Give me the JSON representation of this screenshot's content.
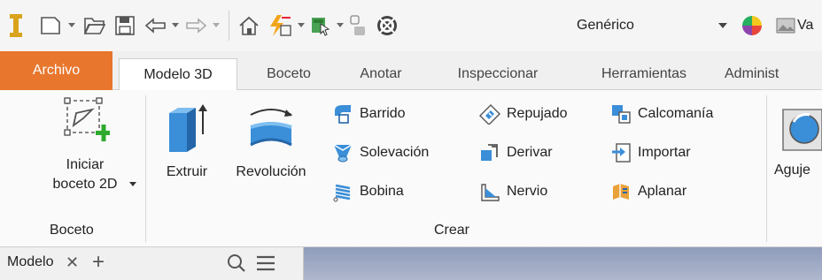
{
  "quick_access": {
    "material_value": "Genérico",
    "appearance_value": "Va"
  },
  "tabs": [
    {
      "label": "Archivo"
    },
    {
      "label": "Modelo 3D"
    },
    {
      "label": "Boceto"
    },
    {
      "label": "Anotar"
    },
    {
      "label": "Inspeccionar"
    },
    {
      "label": "Herramientas"
    },
    {
      "label": "Administ"
    }
  ],
  "ribbon": {
    "boceto_panel": {
      "title": "Boceto",
      "start_sketch_line1": "Iniciar",
      "start_sketch_line2": "boceto 2D"
    },
    "crear_panel": {
      "title": "Crear",
      "extrude": "Extruir",
      "revolve": "Revolución",
      "sweep": "Barrido",
      "loft": "Solevación",
      "coil": "Bobina",
      "emboss": "Repujado",
      "derive": "Derivar",
      "rib": "Nervio",
      "decal": "Calcomanía",
      "import": "Importar",
      "unwrap": "Aplanar"
    },
    "next_panel": {
      "hole": "Aguje"
    }
  },
  "browser": {
    "tab_label": "Modelo",
    "close_glyph": "✕",
    "add_glyph": "+"
  },
  "colors": {
    "file_tab": "#e8762d",
    "accent_blue": "#3b8ed8",
    "add_green": "#2eaa2e"
  }
}
